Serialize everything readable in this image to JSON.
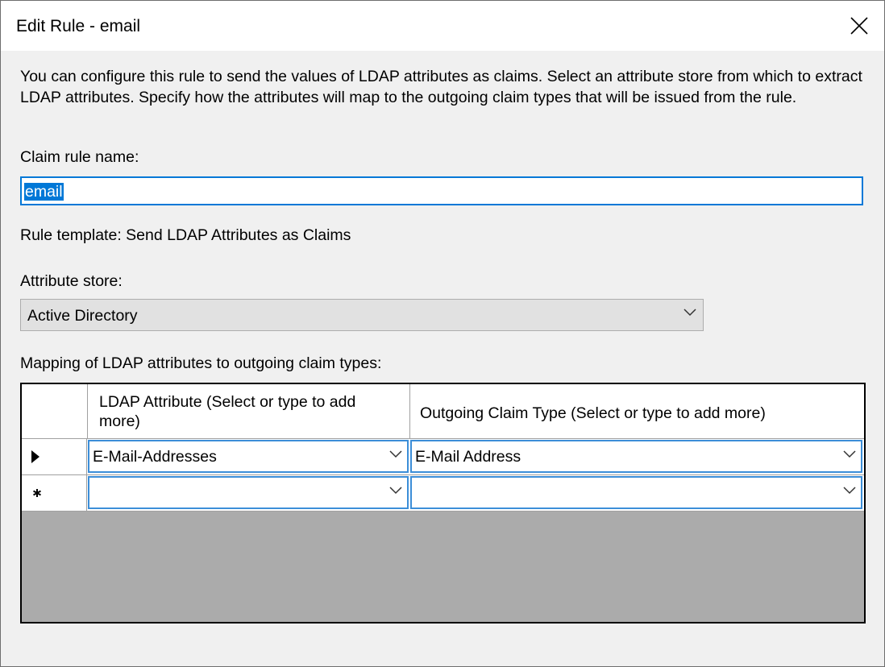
{
  "window": {
    "title": "Edit Rule - email",
    "close_icon": "close-icon"
  },
  "description": "You can configure this rule to send the values of LDAP attributes as claims. Select an attribute store from which to extract LDAP attributes. Specify how the attributes will map to the outgoing claim types that will be issued from the rule.",
  "claim_rule_name": {
    "label": "Claim rule name:",
    "value": "email"
  },
  "rule_template": "Rule template: Send LDAP Attributes as Claims",
  "attribute_store": {
    "label": "Attribute store:",
    "value": "Active Directory"
  },
  "mapping": {
    "label": "Mapping of LDAP attributes to outgoing claim types:",
    "columns": [
      "LDAP Attribute (Select or type to add more)",
      "Outgoing Claim Type (Select or type to add more)"
    ],
    "rows": [
      {
        "indicator": "current-row-arrow-icon",
        "ldap_attribute": "E-Mail-Addresses",
        "claim_type": "E-Mail Address"
      },
      {
        "indicator": "new-row-asterisk-icon",
        "ldap_attribute": "",
        "claim_type": ""
      }
    ]
  },
  "colors": {
    "accent": "#0078d7",
    "window_bg": "#f0f0f0",
    "grid_empty": "#ababab"
  }
}
